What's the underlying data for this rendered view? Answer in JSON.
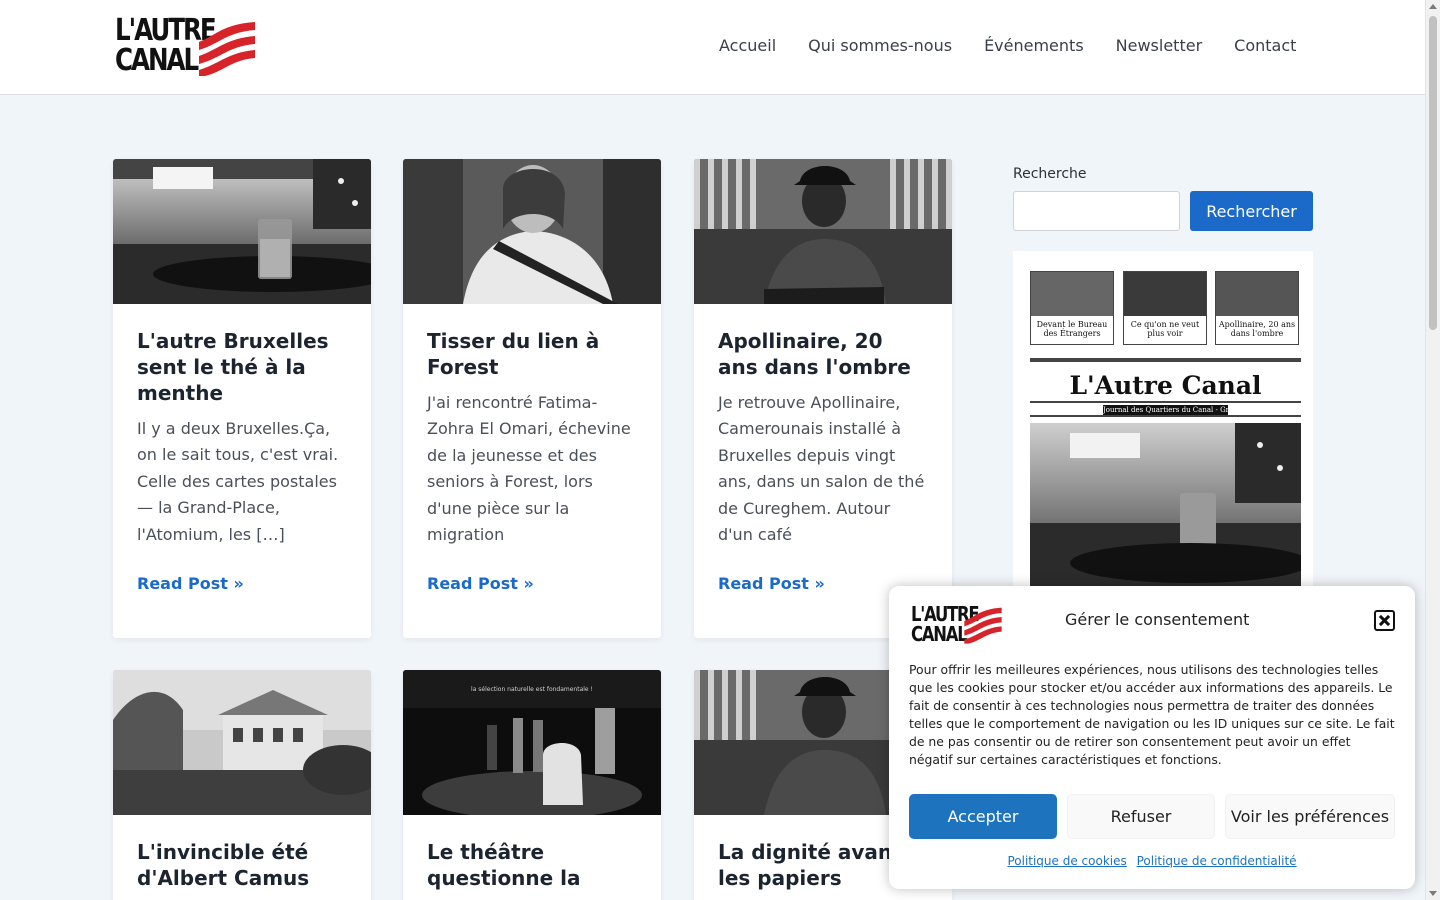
{
  "site": {
    "logo_line1": "L'AUTRE",
    "logo_line2": "CANAL",
    "brand_color": "#d6242a"
  },
  "nav": {
    "items": [
      "Accueil",
      "Qui sommes-nous",
      "Événements",
      "Newsletter",
      "Contact"
    ]
  },
  "posts": [
    {
      "title": "L'autre Bruxelles sent le thé à la menthe",
      "excerpt": "Il y a deux Bruxelles.Ça, on le sait tous, c'est vrai. Celle des cartes postales — la Grand-Place, l'Atomium, les […]",
      "read_more": "Read Post »",
      "image": "glass-of-mint-tea-on-table"
    },
    {
      "title": "Tisser du lien à Forest",
      "excerpt": "J'ai rencontré Fatima-Zohra El Omari, échevine de la jeunesse et des seniors à Forest, lors d'une pièce sur la migration",
      "read_more": "Read Post »",
      "image": "woman-portrait"
    },
    {
      "title": "Apollinaire, 20 ans dans l'ombre",
      "excerpt": "Je retrouve Apollinaire, Camerounais installé à Bruxelles depuis vingt ans, dans un salon de thé de Cureghem. Autour d'un café",
      "read_more": "Read Post »",
      "image": "man-in-cap-portrait"
    },
    {
      "title": "L'invincible été d'Albert Camus",
      "image": "house-and-garden"
    },
    {
      "title": "Le théâtre questionne la",
      "image": "theatre-stage",
      "stage_caption": "la sélection naturelle est fondamentale !"
    },
    {
      "title": "La dignité avant les papiers",
      "image": "man-in-cap-portrait"
    }
  ],
  "sidebar": {
    "search_label": "Recherche",
    "search_button": "Rechercher",
    "search_placeholder": "",
    "journal": {
      "title": "L'Autre Canal",
      "subtitle": "Journal des Quartiers du Canal - Gratuit",
      "thumbs": [
        "Devant le Bureau des Étrangers",
        "Ce qu'on ne veut plus voir",
        "Apollinaire, 20 ans dans l'ombre"
      ]
    }
  },
  "consent": {
    "title": "Gérer le consentement",
    "text": "Pour offrir les meilleures expériences, nous utilisons des technologies telles que les cookies pour stocker et/ou accéder aux informations des appareils. Le fait de consentir à ces technologies nous permettra de traiter des données telles que le comportement de navigation ou les ID uniques sur ce site. Le fait de ne pas consentir ou de retirer son consentement peut avoir un effet négatif sur certaines caractéristiques et fonctions.",
    "accept": "Accepter",
    "refuse": "Refuser",
    "preferences": "Voir les préférences",
    "cookie_policy": "Politique de cookies",
    "privacy_policy": "Politique de confidentialité"
  },
  "colors": {
    "accent": "#1b6ac9",
    "consent_accept": "#1e73be",
    "page_bg": "#f0f5fa"
  }
}
